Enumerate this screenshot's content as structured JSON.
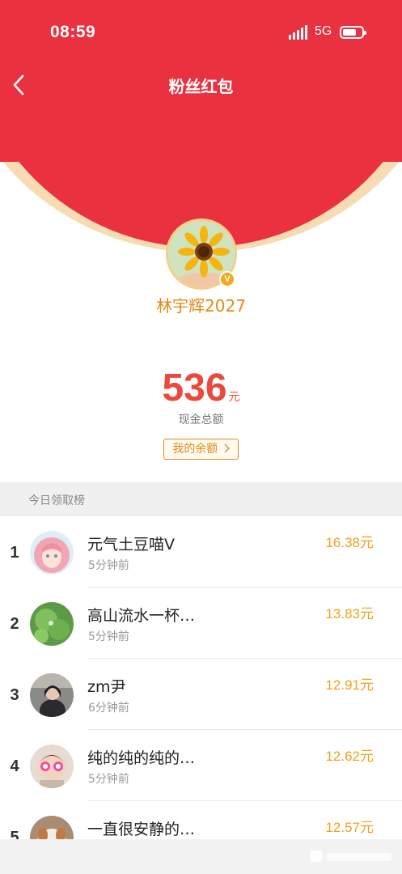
{
  "status_bar": {
    "time": "08:59",
    "network": "5G"
  },
  "nav": {
    "title": "粉丝红包",
    "back_icon": "chevron-left-icon"
  },
  "profile": {
    "username": "林宇辉2027",
    "verified_badge": "V"
  },
  "summary": {
    "amount": "536",
    "unit": "元",
    "label": "现金总额",
    "balance_button": "我的余额"
  },
  "ranking": {
    "title": "今日领取榜",
    "items": [
      {
        "rank": "1",
        "name": "元气土豆喵V",
        "time": "5分钟前",
        "amount": "16.38元"
      },
      {
        "rank": "2",
        "name": "高山流水一杯…",
        "time": "5分钟前",
        "amount": "13.83元"
      },
      {
        "rank": "3",
        "name": "zm尹",
        "time": "6分钟前",
        "amount": "12.91元"
      },
      {
        "rank": "4",
        "name": "纯的纯的纯的…",
        "time": "5分钟前",
        "amount": "12.62元"
      },
      {
        "rank": "5",
        "name": "一直很安静的…",
        "time": "",
        "amount": "12.57元"
      }
    ]
  },
  "colors": {
    "header_red": "#e93140",
    "accent_orange": "#e48a14",
    "amount_red": "#ea4a3b",
    "rank_amount": "#f0a01e"
  }
}
